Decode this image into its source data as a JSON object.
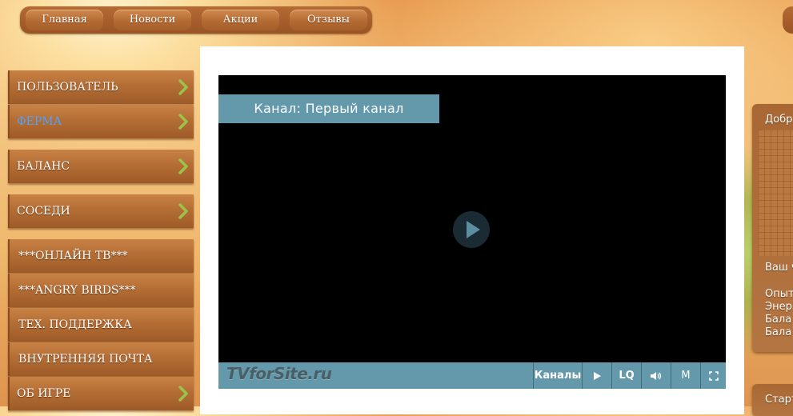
{
  "top_nav": {
    "items": [
      {
        "label": "Главная"
      },
      {
        "label": "Новости"
      },
      {
        "label": "Акции"
      },
      {
        "label": "Отзывы"
      }
    ]
  },
  "left_menu": {
    "items": [
      {
        "label": "ПОЛЬЗОВАТЕЛЬ",
        "active": false
      },
      {
        "label": "ФЕРМА",
        "active": true
      },
      {
        "label": "БАЛАНС",
        "active": false
      },
      {
        "label": "СОСЕДИ",
        "active": false
      },
      {
        "label": "***ОНЛАЙН ТВ***",
        "active": false
      },
      {
        "label": "***ANGRY BIRDS***",
        "active": false
      },
      {
        "label": "ТЕХ. ПОДДЕРЖКА",
        "active": false
      },
      {
        "label": "ВНУТРЕННЯЯ ПОЧТА",
        "active": false
      },
      {
        "label": "ОБ ИГРЕ",
        "active": false
      }
    ]
  },
  "player": {
    "channel_label": "Канал: Первый канал",
    "logo_text": "TVforSite.ru",
    "controls": {
      "channels_label": "Каналы",
      "quality_label": "LQ",
      "mute_label": "M"
    },
    "colors": {
      "bar": "#6399ab",
      "screen": "#000000"
    },
    "icons": [
      "play-icon",
      "volume-icon",
      "fullscreen-icon"
    ]
  },
  "right_panel": {
    "greeting": "Добр",
    "your": "Ваш ч",
    "stats": [
      "Опыт",
      "Энер",
      "Бала",
      "Бала"
    ],
    "bottom": "Старт"
  }
}
